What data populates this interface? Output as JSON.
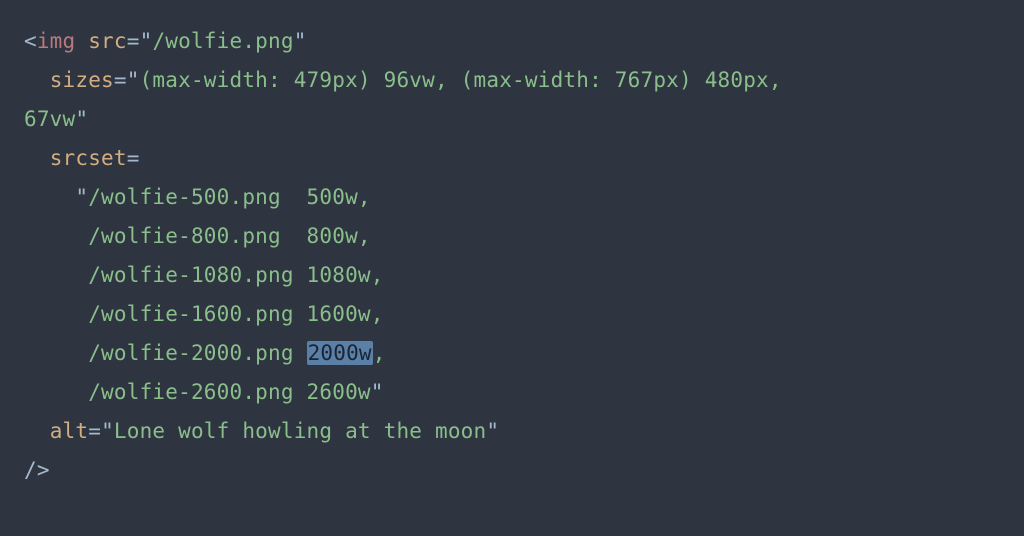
{
  "code": {
    "tag": "img",
    "src": "/wolfie.png",
    "attr_src": "src",
    "attr_sizes": "sizes",
    "attr_srcset": "srcset",
    "attr_alt": "alt",
    "sizes_line1": "(max-width: 479px) 96vw, (max-width: 767px) 480px, ",
    "sizes_line2": "67vw",
    "srcset": {
      "l1": "/wolfie-500.png  500w,",
      "l2": "     /wolfie-800.png  800w,",
      "l3": "     /wolfie-1080.png 1080w,",
      "l4": "     /wolfie-1600.png 1600w,",
      "l5a": "     /wolfie-2000.png ",
      "l5_sel": "2000w",
      "l5b": ",",
      "l6": "     /wolfie-2600.png 2600w"
    },
    "alt": "Lone wolf howling at the moon",
    "eq": "=",
    "q": "\"",
    "lt": "<",
    "gt": "/>"
  }
}
